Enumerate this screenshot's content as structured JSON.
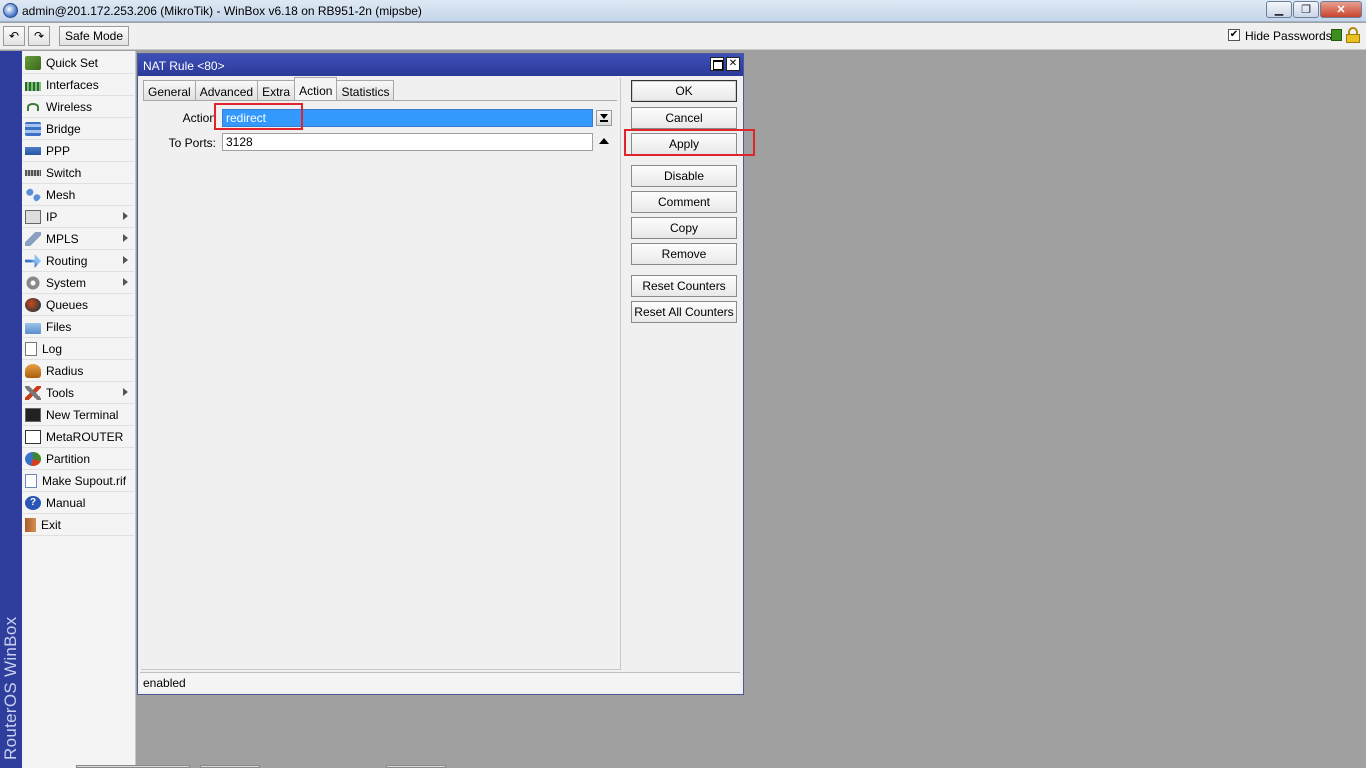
{
  "window": {
    "title": "admin@201.172.253.206 (MikroTik) - WinBox v6.18 on RB951-2n (mipsbe)",
    "controls": {
      "minimize": "▁",
      "maximize": "❐",
      "close": "✕"
    }
  },
  "toolbar": {
    "undo_icon": "↶",
    "redo_icon": "↷",
    "safe_mode_label": "Safe Mode",
    "hide_passwords_label": "Hide Passwords",
    "hide_passwords_checked": "✔"
  },
  "brand": {
    "text": "RouterOS WinBox"
  },
  "sidebar": {
    "items": [
      {
        "label": "Quick Set",
        "icon": "quick-set-icon"
      },
      {
        "label": "Interfaces",
        "icon": "interfaces-icon"
      },
      {
        "label": "Wireless",
        "icon": "wireless-icon"
      },
      {
        "label": "Bridge",
        "icon": "bridge-icon"
      },
      {
        "label": "PPP",
        "icon": "ppp-icon"
      },
      {
        "label": "Switch",
        "icon": "switch-icon"
      },
      {
        "label": "Mesh",
        "icon": "mesh-icon"
      },
      {
        "label": "IP",
        "icon": "ip-icon",
        "submenu": true
      },
      {
        "label": "MPLS",
        "icon": "mpls-icon",
        "submenu": true
      },
      {
        "label": "Routing",
        "icon": "routing-icon",
        "submenu": true
      },
      {
        "label": "System",
        "icon": "system-icon",
        "submenu": true
      },
      {
        "label": "Queues",
        "icon": "queues-icon"
      },
      {
        "label": "Files",
        "icon": "files-icon"
      },
      {
        "label": "Log",
        "icon": "log-icon"
      },
      {
        "label": "Radius",
        "icon": "radius-icon"
      },
      {
        "label": "Tools",
        "icon": "tools-icon",
        "submenu": true
      },
      {
        "label": "New Terminal",
        "icon": "terminal-icon"
      },
      {
        "label": "MetaROUTER",
        "icon": "metarouter-icon"
      },
      {
        "label": "Partition",
        "icon": "partition-icon"
      },
      {
        "label": "Make Supout.rif",
        "icon": "supout-icon"
      },
      {
        "label": "Manual",
        "icon": "manual-icon"
      },
      {
        "label": "Exit",
        "icon": "exit-icon"
      }
    ]
  },
  "dialog": {
    "title": "NAT Rule <80>",
    "tabs": [
      "General",
      "Advanced",
      "Extra",
      "Action",
      "Statistics"
    ],
    "active_tab": "Action",
    "fields": {
      "action_label": "Action",
      "action_value": "redirect",
      "to_ports_label": "To Ports:",
      "to_ports_value": "3128"
    },
    "buttons": {
      "ok": "OK",
      "cancel": "Cancel",
      "apply": "Apply",
      "disable": "Disable",
      "comment": "Comment",
      "copy": "Copy",
      "remove": "Remove",
      "reset_counters": "Reset Counters",
      "reset_all_counters": "Reset All Counters"
    },
    "status": "enabled"
  },
  "colors": {
    "brand_strip": "#2f3e9c",
    "dialog_title": "#2b3a98",
    "selection": "#3399ff",
    "highlight": "#e0242c",
    "desktop": "#a0a0a0"
  }
}
